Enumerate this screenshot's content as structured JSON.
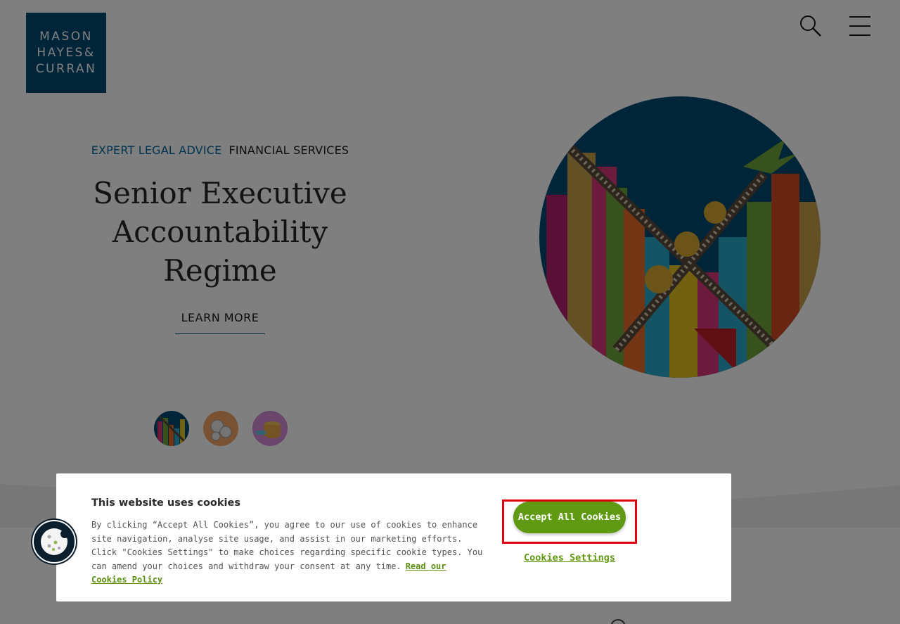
{
  "header": {
    "logo_lines": [
      "MASON",
      "HAYES&",
      "CURRAN"
    ],
    "search_icon": "search-icon",
    "menu_icon": "hamburger-menu-icon"
  },
  "hero": {
    "breadcrumb_primary": "EXPERT LEGAL ADVICE",
    "breadcrumb_secondary": "FINANCIAL SERVICES",
    "title_line_1": "Senior Executive",
    "title_line_2": "Accountability",
    "title_line_3": "Regime",
    "cta_label": "LEARN MORE",
    "slides": [
      {
        "icon": "financial-chart-thumbnail",
        "active": true
      },
      {
        "icon": "coins-thumbnail",
        "active": false
      },
      {
        "icon": "data-cylinder-thumbnail",
        "active": false
      }
    ]
  },
  "cookie_banner": {
    "title": "This website uses cookies",
    "body": "By clicking “Accept All Cookies”, you agree to our use of cookies to enhance site navigation, analyse site usage, and assist in our marketing efforts. Click \"Cookies Settings\" to make choices regarding specific cookie types. You can amend your choices and withdraw your consent at any time.",
    "policy_link": "Read our Cookies Policy",
    "accept_label": "Accept All Cookies",
    "settings_label": "Cookies Settings",
    "fab_icon": "cookie-icon"
  },
  "colors": {
    "brand_blue": "#004a72",
    "link_blue": "#00669c",
    "cookie_green": "#5f9a12",
    "highlight_red": "#e1000f"
  }
}
